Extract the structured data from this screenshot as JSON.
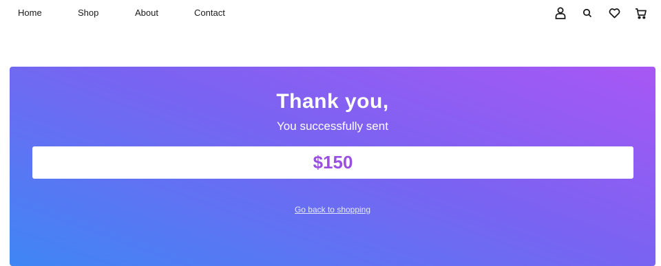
{
  "nav": {
    "links": [
      "Home",
      "Shop",
      "About",
      "Contact"
    ],
    "icons": [
      "user-icon",
      "search-icon",
      "heart-icon",
      "cart-icon"
    ]
  },
  "confirmation": {
    "title": "Thank you,",
    "subtitle": "You successfully sent",
    "amount": "$150",
    "back_link": "Go back to shopping"
  },
  "colors": {
    "gradient_start": "#a857f4",
    "gradient_end": "#3f86f4",
    "amount": "#9a4fe3"
  }
}
